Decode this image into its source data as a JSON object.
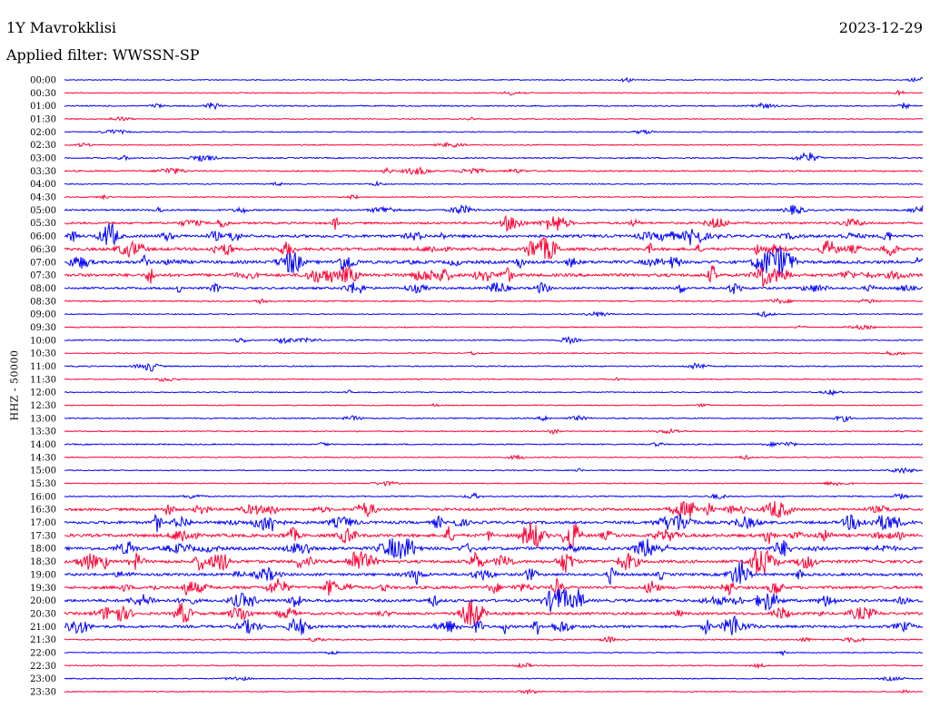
{
  "header": {
    "station": "1Y Mavrokklisi",
    "date": "2023-12-29",
    "filter": "Applied filter: WWSSN-SP"
  },
  "chart_data": {
    "type": "line",
    "title": "1Y Mavrokklisi",
    "ylabel": "HHZ - 50000",
    "line_colors": [
      "#0000ff",
      "#ff0033"
    ],
    "times": [
      "00:00",
      "00:30",
      "01:00",
      "01:30",
      "02:00",
      "02:30",
      "03:00",
      "03:30",
      "04:00",
      "04:30",
      "05:00",
      "05:30",
      "06:00",
      "06:30",
      "07:00",
      "07:30",
      "08:00",
      "08:30",
      "09:00",
      "09:30",
      "10:00",
      "10:30",
      "11:00",
      "11:30",
      "12:00",
      "12:30",
      "13:00",
      "13:30",
      "14:00",
      "14:30",
      "15:00",
      "15:30",
      "16:00",
      "16:30",
      "17:00",
      "17:30",
      "18:00",
      "18:30",
      "19:00",
      "19:30",
      "20:00",
      "20:30",
      "21:00",
      "21:30",
      "22:00",
      "22:30",
      "23:00",
      "23:30"
    ],
    "activity_level": [
      0.1,
      0.1,
      0.2,
      0.1,
      0.1,
      0.1,
      0.2,
      0.3,
      0.1,
      0.1,
      0.4,
      0.6,
      0.9,
      0.9,
      1.0,
      1.0,
      0.6,
      0.2,
      0.1,
      0.1,
      0.2,
      0.1,
      0.2,
      0.1,
      0.1,
      0.1,
      0.2,
      0.1,
      0.2,
      0.1,
      0.1,
      0.1,
      0.2,
      0.8,
      0.9,
      1.0,
      1.0,
      1.0,
      0.8,
      0.9,
      0.9,
      0.8,
      0.8,
      0.2,
      0.1,
      0.1,
      0.1,
      0.1
    ]
  }
}
